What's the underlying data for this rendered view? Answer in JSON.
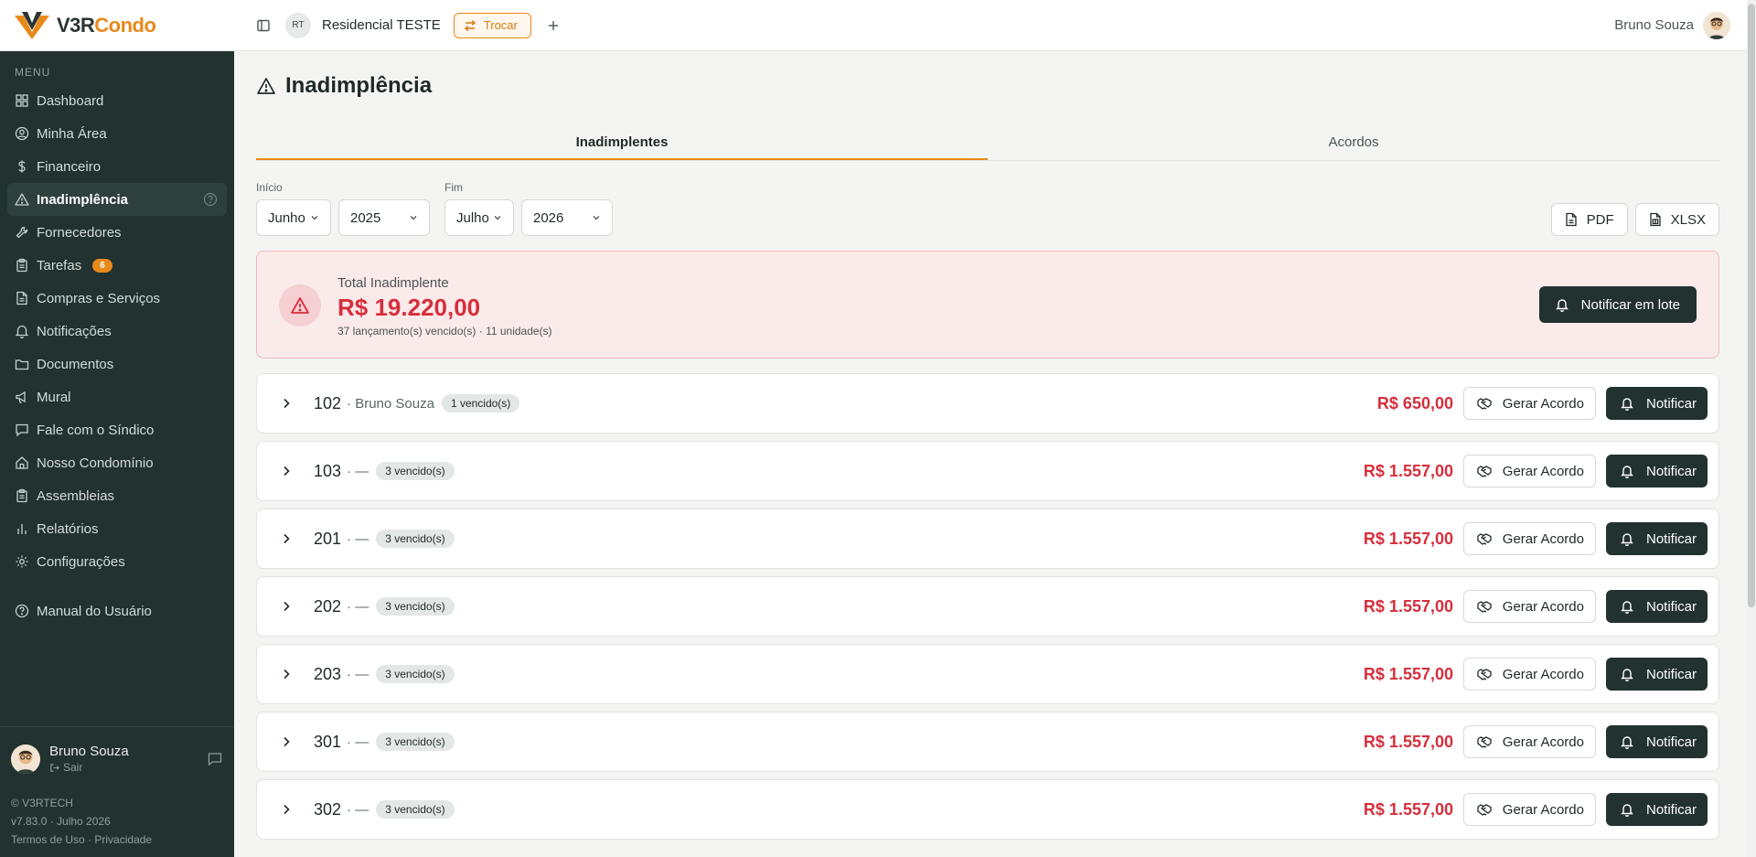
{
  "brand": {
    "part1": "V3R",
    "part2": "Condo"
  },
  "topbar": {
    "rt_badge": "RT",
    "condo_name": "Residencial TESTE",
    "trocar_label": "Trocar",
    "user_name": "Bruno Souza"
  },
  "sidebar": {
    "menu_label": "MENU",
    "items": [
      {
        "label": "Dashboard",
        "icon": "dashboard-icon"
      },
      {
        "label": "Minha Área",
        "icon": "user-circle-icon"
      },
      {
        "label": "Financeiro",
        "icon": "dollar-icon"
      },
      {
        "label": "Inadimplência",
        "icon": "warning-icon",
        "active": true
      },
      {
        "label": "Fornecedores",
        "icon": "wrench-icon"
      },
      {
        "label": "Tarefas",
        "icon": "clipboard-icon",
        "badge": "6"
      },
      {
        "label": "Compras e Serviços",
        "icon": "document-icon"
      },
      {
        "label": "Notificações",
        "icon": "bell-icon"
      },
      {
        "label": "Documentos",
        "icon": "folder-icon"
      },
      {
        "label": "Mural",
        "icon": "megaphone-icon"
      },
      {
        "label": "Fale com o Síndico",
        "icon": "chat-icon"
      },
      {
        "label": "Nosso Condomínio",
        "icon": "home-icon"
      },
      {
        "label": "Assembleias",
        "icon": "clipboard-icon"
      },
      {
        "label": "Relatórios",
        "icon": "bar-chart-icon"
      },
      {
        "label": "Configurações",
        "icon": "gear-icon"
      }
    ],
    "manual_label": "Manual do Usuário",
    "user_name": "Bruno Souza",
    "exit_label": "Sair",
    "footer": {
      "company": "© V3RTECH",
      "version": "v7.83.0 · Julho 2026",
      "terms": "Termos de Uso",
      "separator": "·",
      "privacy": "Privacidade"
    }
  },
  "page": {
    "title": "Inadimplência",
    "tabs": [
      "Inadimplentes",
      "Acordos"
    ],
    "filters": {
      "start_label": "Início",
      "start_month": "Junho",
      "start_year": "2025",
      "end_label": "Fim",
      "end_month": "Julho",
      "end_year": "2026"
    },
    "export": {
      "pdf": "PDF",
      "xlsx": "XLSX"
    },
    "summary": {
      "label": "Total Inadimplente",
      "value": "R$ 19.220,00",
      "sub": "37 lançamento(s) vencido(s) · 11 unidade(s)",
      "notify_all": "Notificar em lote"
    },
    "row_actions": {
      "acordo": "Gerar Acordo",
      "notificar": "Notificar"
    },
    "rows": [
      {
        "unit": "102",
        "owner": "· Bruno Souza",
        "badge": "1 vencido(s)",
        "amount": "R$ 650,00"
      },
      {
        "unit": "103",
        "owner": "· —",
        "badge": "3 vencido(s)",
        "amount": "R$ 1.557,00"
      },
      {
        "unit": "201",
        "owner": "· —",
        "badge": "3 vencido(s)",
        "amount": "R$ 1.557,00"
      },
      {
        "unit": "202",
        "owner": "· —",
        "badge": "3 vencido(s)",
        "amount": "R$ 1.557,00"
      },
      {
        "unit": "203",
        "owner": "· —",
        "badge": "3 vencido(s)",
        "amount": "R$ 1.557,00"
      },
      {
        "unit": "301",
        "owner": "· —",
        "badge": "3 vencido(s)",
        "amount": "R$ 1.557,00"
      },
      {
        "unit": "302",
        "owner": "· —",
        "badge": "3 vencido(s)",
        "amount": "R$ 1.557,00"
      }
    ]
  },
  "colors": {
    "accent": "#e8891c",
    "sidebar_bg": "#223230",
    "danger": "#d62e3c"
  }
}
